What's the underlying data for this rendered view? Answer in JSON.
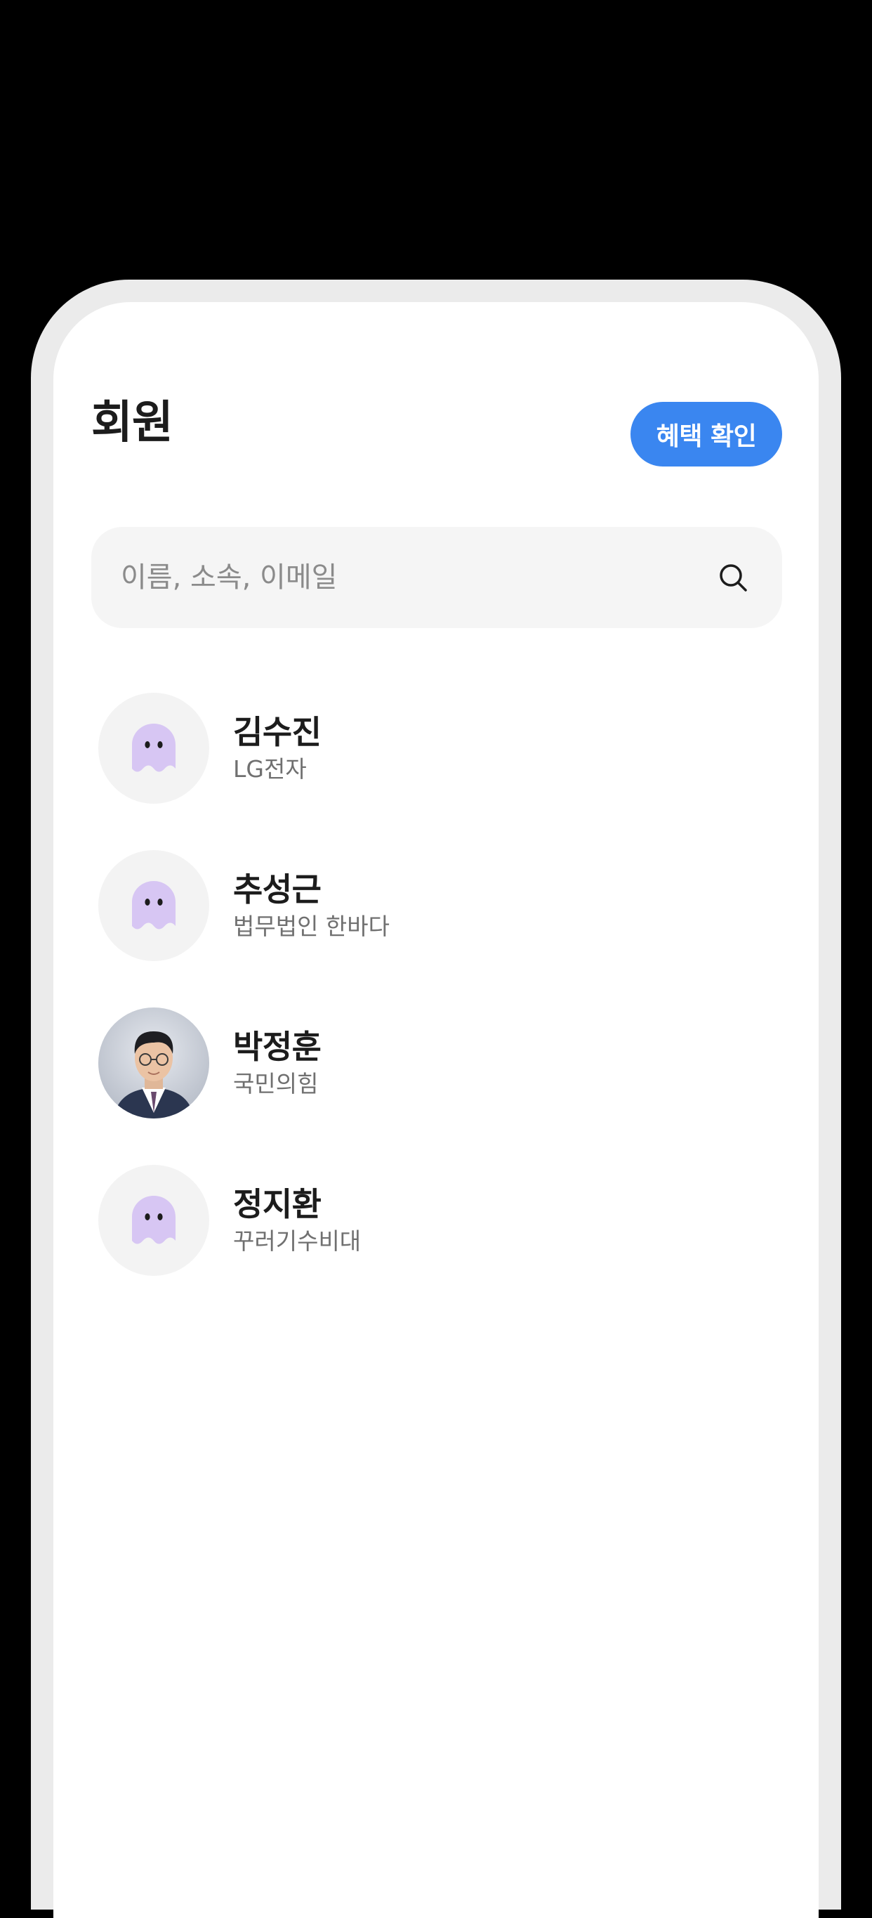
{
  "header": {
    "title": "회원",
    "benefit_button_label": "혜택 확인"
  },
  "search": {
    "placeholder": "이름, 소속, 이메일",
    "value": "",
    "icon": "search-icon"
  },
  "members": [
    {
      "name": "김수진",
      "org": "LG전자",
      "avatar": "ghost-icon"
    },
    {
      "name": "추성근",
      "org": "법무법인 한바다",
      "avatar": "ghost-icon"
    },
    {
      "name": "박정훈",
      "org": "국민의힘",
      "avatar": "profile-photo"
    },
    {
      "name": "정지환",
      "org": "꾸러기수비대",
      "avatar": "ghost-icon"
    }
  ],
  "colors": {
    "accent": "#3a86f0",
    "ghost": "#d7c6f3",
    "avatar_bg": "#f3f3f3",
    "search_bg": "#f5f5f5"
  }
}
